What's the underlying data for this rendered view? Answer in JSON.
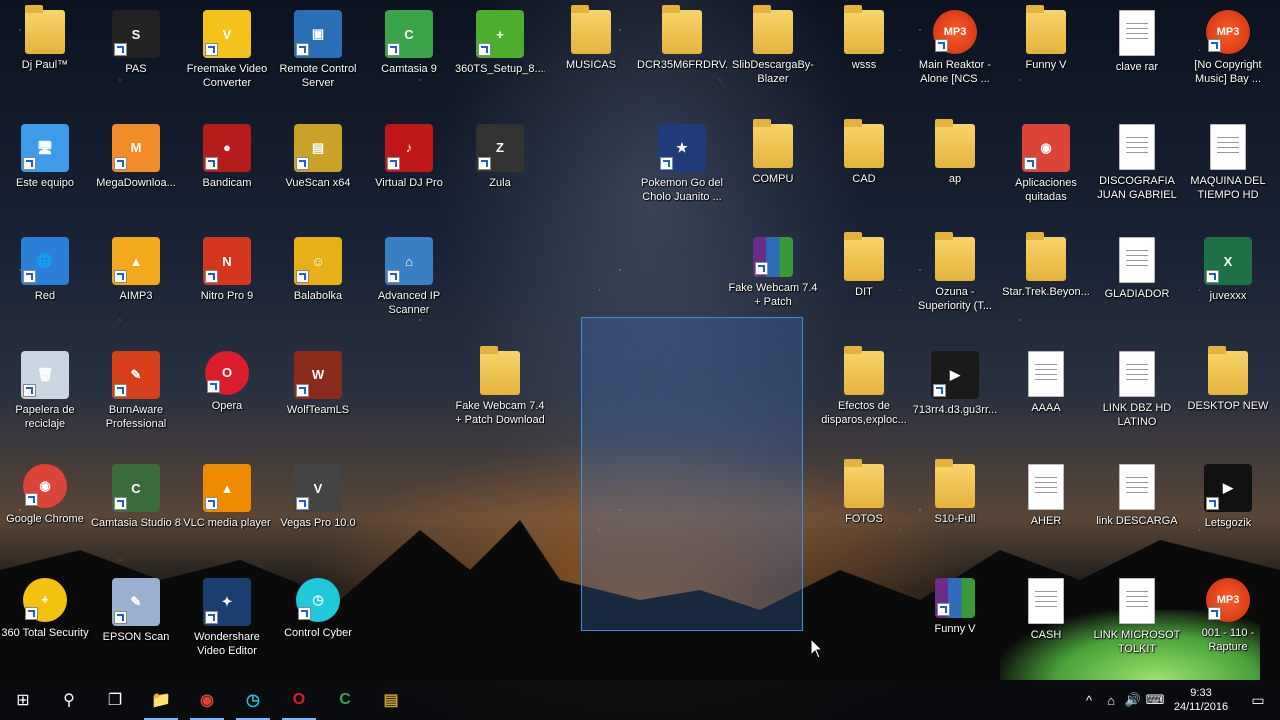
{
  "desktop": {
    "icons": [
      {
        "label": "Dj Paul™",
        "type": "folder",
        "color": "#f1c84f"
      },
      {
        "label": "PAS",
        "type": "app",
        "color": "#222222",
        "glyph": "S"
      },
      {
        "label": "Freemake Video Converter",
        "type": "app",
        "color": "#f4c21a",
        "glyph": "V"
      },
      {
        "label": "Remote Control Server",
        "type": "app",
        "color": "#2a6fb5",
        "glyph": "▣"
      },
      {
        "label": "Camtasia 9",
        "type": "app",
        "color": "#3aa34a",
        "glyph": "C"
      },
      {
        "label": "360TS_Setup_8....",
        "type": "app",
        "color": "#4cae2c",
        "glyph": "+"
      },
      {
        "label": "MUSICAS",
        "type": "folder",
        "color": "#f1c84f"
      },
      {
        "label": "DCR35M6FRDRV...",
        "type": "folder",
        "color": "#ffffff"
      },
      {
        "label": "SlibDescargaBy-Blazer",
        "type": "folder",
        "color": "#f1c84f"
      },
      {
        "label": "wsss",
        "type": "folder",
        "color": "#f1c84f"
      },
      {
        "label": "Main Reaktor - Alone [NCS ...",
        "type": "mp3",
        "color": "#e8491d",
        "glyph": "MP3"
      },
      {
        "label": "Funny V",
        "type": "folder",
        "color": "#f1c84f"
      },
      {
        "label": "clave rar",
        "type": "doc",
        "color": "#ffffff"
      },
      {
        "label": "[No Copyright Music] Bay ...",
        "type": "mp3",
        "color": "#e8491d",
        "glyph": "MP3"
      },
      {
        "label": "Este equipo",
        "type": "app",
        "color": "#3d9be9",
        "glyph": "🖥"
      },
      {
        "label": "MegaDownloa...",
        "type": "app",
        "color": "#f28c28",
        "glyph": "M"
      },
      {
        "label": "Bandicam",
        "type": "app",
        "color": "#b51d1d",
        "glyph": "●"
      },
      {
        "label": "VueScan x64",
        "type": "app",
        "color": "#c9a227",
        "glyph": "▤"
      },
      {
        "label": "Virtual DJ Pro",
        "type": "app",
        "color": "#c01818",
        "glyph": "♪"
      },
      {
        "label": "Zula",
        "type": "app",
        "color": "#333333",
        "glyph": "Z"
      },
      {
        "label": "Pokemon Go del Cholo Juanito ...",
        "type": "app",
        "color": "#1f3b7a",
        "glyph": "★"
      },
      {
        "label": "COMPU",
        "type": "folder",
        "color": "#f1c84f"
      },
      {
        "label": "CAD",
        "type": "folder",
        "color": "#f1c84f"
      },
      {
        "label": "ap",
        "type": "folder",
        "color": "#f1c84f"
      },
      {
        "label": "Aplicaciones quitadas",
        "type": "app",
        "color": "#db4437",
        "glyph": "◉"
      },
      {
        "label": "DISCOGRAFIA JUAN GABRIEL",
        "type": "doc",
        "color": "#ffffff"
      },
      {
        "label": "MAQUINA DEL TIEMPO HD",
        "type": "doc",
        "color": "#ffffff"
      },
      {
        "label": "Red",
        "type": "app",
        "color": "#2b7fd6",
        "glyph": "🌐"
      },
      {
        "label": "AIMP3",
        "type": "app",
        "color": "#f2a91b",
        "glyph": "▲"
      },
      {
        "label": "Nitro Pro 9",
        "type": "app",
        "color": "#d5361d",
        "glyph": "N"
      },
      {
        "label": "Balabolka",
        "type": "app",
        "color": "#e8b018",
        "glyph": "☺"
      },
      {
        "label": "Advanced IP Scanner",
        "type": "app",
        "color": "#3a7fc4",
        "glyph": "⌂"
      },
      {
        "label": "Fake Webcam 7.4 + Patch",
        "type": "winrar",
        "color": "#6b2c8a"
      },
      {
        "label": "DIT",
        "type": "folder",
        "color": "#f1c84f"
      },
      {
        "label": "Ozuna - Superiority (T...",
        "type": "folder",
        "color": "#f1c84f"
      },
      {
        "label": "Star.Trek.Beyon...",
        "type": "folder",
        "color": "#f1c84f"
      },
      {
        "label": "GLADIADOR",
        "type": "doc",
        "color": "#ffffff"
      },
      {
        "label": "juvexxx",
        "type": "app",
        "color": "#1e7145",
        "glyph": "X"
      },
      {
        "label": "Papelera de reciclaje",
        "type": "app",
        "color": "#c9d6e2",
        "glyph": "🗑"
      },
      {
        "label": "BurnAware Professional",
        "type": "app",
        "color": "#d8401c",
        "glyph": "✎"
      },
      {
        "label": "Opera",
        "type": "round",
        "color": "#d91d2a",
        "glyph": "O"
      },
      {
        "label": "WolfTeamLS",
        "type": "app",
        "color": "#8a2b1b",
        "glyph": "W"
      },
      {
        "label": "Fake Webcam 7.4 + Patch Download",
        "type": "folder",
        "color": "#f1c84f"
      },
      {
        "label": "Efectos de disparos,exploc...",
        "type": "folder",
        "color": "#f1c84f"
      },
      {
        "label": "713rr4.d3.gu3rr...",
        "type": "app",
        "color": "#1a1a1a",
        "glyph": "▶"
      },
      {
        "label": "AAAA",
        "type": "doc",
        "color": "#ffffff"
      },
      {
        "label": "LINK DBZ HD LATINO",
        "type": "doc",
        "color": "#ffffff"
      },
      {
        "label": "DESKTOP NEW",
        "type": "folder",
        "color": "#f1c84f"
      },
      {
        "label": "Google Chrome",
        "type": "round",
        "color": "#db4437",
        "glyph": "◉"
      },
      {
        "label": "Camtasia Studio 8",
        "type": "app",
        "color": "#3a6b3a",
        "glyph": "C"
      },
      {
        "label": "VLC media player",
        "type": "app",
        "color": "#f08a00",
        "glyph": "▲"
      },
      {
        "label": "Vegas Pro 10.0",
        "type": "app",
        "color": "#444444",
        "glyph": "V"
      },
      {
        "label": "FOTOS",
        "type": "folder",
        "color": "#f1c84f"
      },
      {
        "label": "S10-Full",
        "type": "folder",
        "color": "#f1c84f"
      },
      {
        "label": "AHER",
        "type": "doc",
        "color": "#ffffff"
      },
      {
        "label": "link DESCARGA",
        "type": "doc",
        "color": "#ffffff"
      },
      {
        "label": "Letsgozik",
        "type": "app",
        "color": "#111111",
        "glyph": "▶"
      },
      {
        "label": "360 Total Security",
        "type": "round",
        "color": "#f2c20f",
        "glyph": "+"
      },
      {
        "label": "EPSON Scan",
        "type": "app",
        "color": "#9ab0d0",
        "glyph": "✎"
      },
      {
        "label": "Wondershare Video Editor",
        "type": "app",
        "color": "#1a3f6e",
        "glyph": "✦"
      },
      {
        "label": "Control Cyber",
        "type": "round",
        "color": "#1fc9d9",
        "glyph": "◷"
      },
      {
        "label": "Funny V",
        "type": "winrar",
        "color": "#6b2c8a"
      },
      {
        "label": "CASH",
        "type": "doc",
        "color": "#ffffff"
      },
      {
        "label": "LINK MICROSOT TOLKIT",
        "type": "doc",
        "color": "#ffffff"
      },
      {
        "label": "001 - 110 - Rapture",
        "type": "mp3",
        "color": "#e8491d",
        "glyph": "MP3"
      }
    ]
  },
  "taskbar": {
    "start_glyph": "⊞",
    "search_glyph": "⚲",
    "taskview_glyph": "❐",
    "pinned": [
      {
        "name": "file-explorer",
        "glyph": "📁",
        "color": "#f1c84f"
      },
      {
        "name": "chrome",
        "glyph": "◉",
        "color": "#db4437"
      },
      {
        "name": "control-cyber",
        "glyph": "◷",
        "color": "#1fc9d9"
      },
      {
        "name": "opera",
        "glyph": "O",
        "color": "#d91d2a"
      },
      {
        "name": "camtasia",
        "glyph": "C",
        "color": "#3aa34a"
      },
      {
        "name": "vuescan",
        "glyph": "▤",
        "color": "#c9a227"
      }
    ],
    "tray": {
      "chevron": "^",
      "network": "⌂",
      "volume": "🔊",
      "keyboard": "⌨",
      "time": "9:33",
      "date": "24/11/2016",
      "notification": "▭"
    }
  }
}
